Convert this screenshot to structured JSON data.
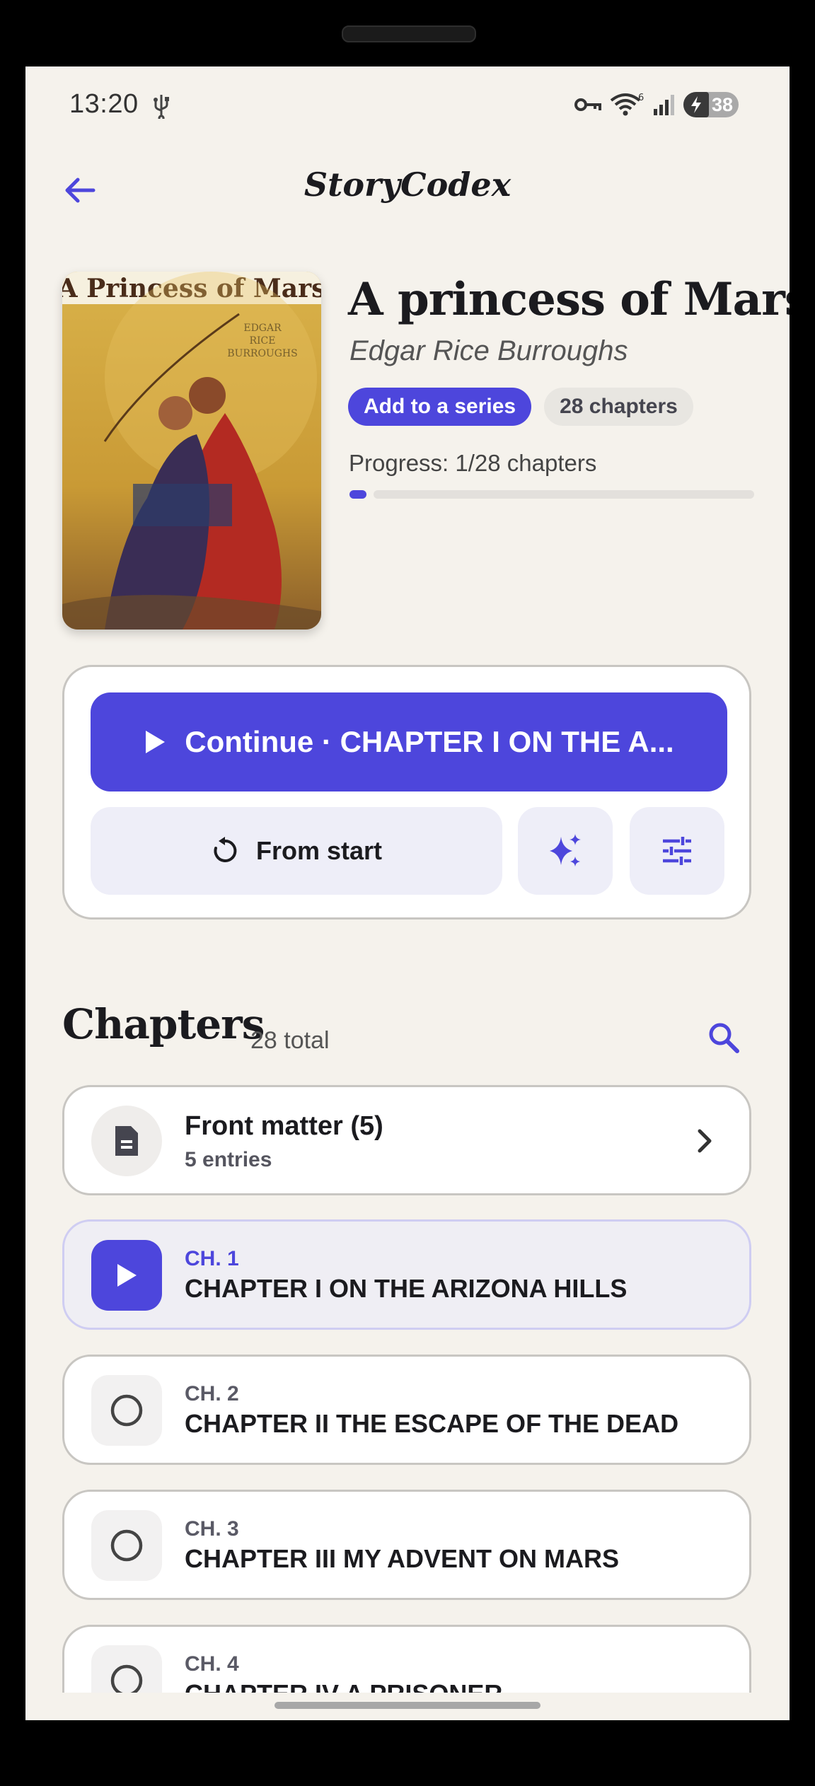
{
  "status": {
    "time": "13:20",
    "wifi_badge": "6",
    "battery": "38"
  },
  "app": {
    "title": "StoryCodex"
  },
  "book": {
    "title": "A princess of Mars",
    "author": "Edgar Rice Burroughs",
    "series_chip": "Add to a series",
    "chapters_chip": "28 chapters",
    "progress_label": "Progress: 1/28 chapters",
    "progress_fraction": 0.036,
    "cover_title": "A Princess of Mars",
    "cover_author_lines": [
      "EDGAR",
      "RICE",
      "BURROUGHS"
    ]
  },
  "actions": {
    "continue_label": "Continue · CHAPTER I ON THE A...",
    "from_start_label": "From start"
  },
  "chapters": {
    "heading": "Chapters",
    "count": "28 total",
    "front_matter": {
      "title": "Front matter (5)",
      "sub": "5 entries"
    },
    "items": [
      {
        "num": "CH. 1",
        "title": "CHAPTER I ON THE ARIZONA HILLS"
      },
      {
        "num": "CH. 2",
        "title": "CHAPTER II THE ESCAPE OF THE DEAD"
      },
      {
        "num": "CH. 3",
        "title": "CHAPTER III MY ADVENT ON MARS"
      },
      {
        "num": "CH. 4",
        "title": "CHAPTER IV A PRISONER"
      }
    ]
  },
  "colors": {
    "accent": "#4d46dc",
    "background": "#f5f2ec"
  }
}
